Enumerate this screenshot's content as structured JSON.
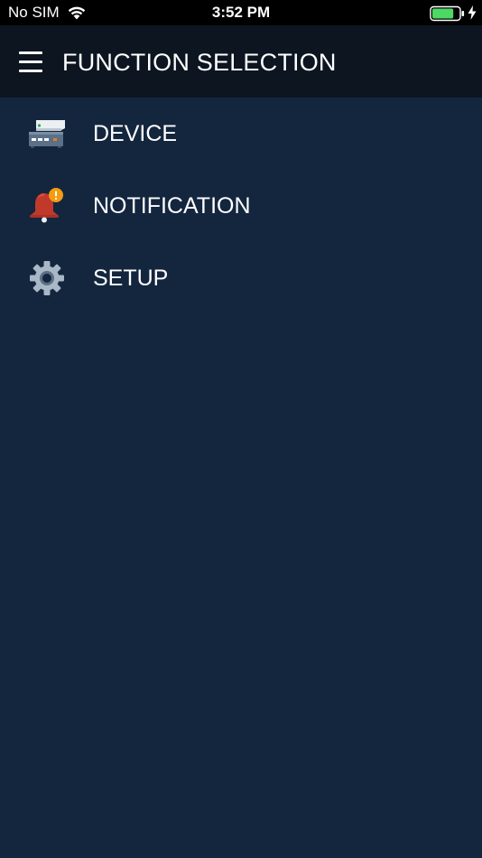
{
  "status_bar": {
    "carrier": "No SIM",
    "time": "3:52 PM",
    "battery_level": 0.8,
    "battery_color": "#4cd964"
  },
  "header": {
    "title": "FUNCTION SELECTION",
    "menu_icon": "hamburger-menu-icon"
  },
  "menu": {
    "items": [
      {
        "label": "DEVICE",
        "icon": "device-icon"
      },
      {
        "label": "NOTIFICATION",
        "icon": "notification-bell-icon"
      },
      {
        "label": "SETUP",
        "icon": "gear-icon"
      }
    ]
  },
  "colors": {
    "background": "#13263e",
    "header_background": "#0c1520",
    "text": "#ffffff",
    "notification_bell": "#c0392b",
    "notification_badge": "#f39c12",
    "gear": "#a9b7c6"
  }
}
